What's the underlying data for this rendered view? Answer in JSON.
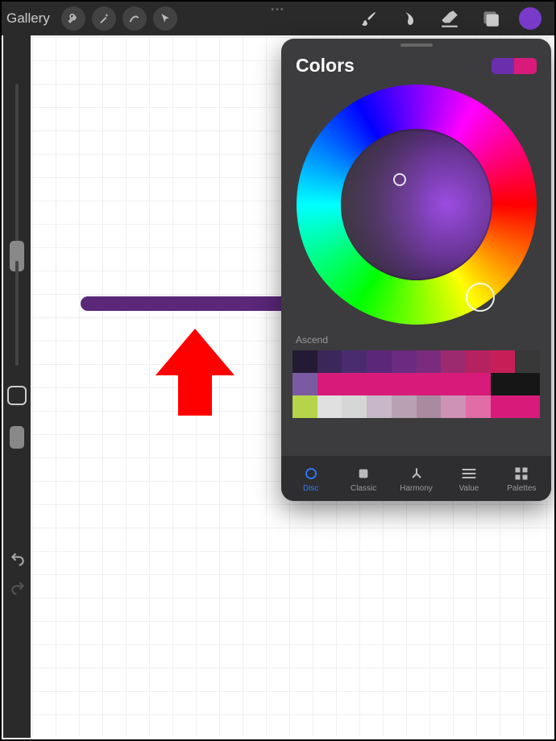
{
  "topbar": {
    "gallery_label": "Gallery"
  },
  "colors_panel": {
    "title": "Colors",
    "history_label": "Ascend",
    "current_color": "#7a3bcb",
    "secondary_color": "#d81b7a",
    "tabs": {
      "disc": "Disc",
      "classic": "Classic",
      "harmony": "Harmony",
      "value": "Value",
      "palettes": "Palettes"
    },
    "active_tab": "Disc",
    "palette_rows": [
      [
        "#231a33",
        "#3b2759",
        "#4b2b70",
        "#5a2779",
        "#6b2b80",
        "#7b2b7e",
        "#9b2b6e",
        "#b52260",
        "#c81e58",
        "#383838"
      ],
      [
        "#7a5aa0",
        "#d81b7a",
        "#d81b7a",
        "#d81b7a",
        "#d81b7a",
        "#d81b7a",
        "#d81b7a",
        "#d81b7a",
        "#161616",
        "#161616"
      ],
      [
        "#b6d44a",
        "#e0e0e0",
        "#d6d6d6",
        "#c7b7c8",
        "#b7a1b3",
        "#a88b9e",
        "#cf92b7",
        "#e06da6",
        "#d81b7a",
        "#d81b7a"
      ]
    ]
  },
  "annotation": {
    "stroke_color": "#5a2779",
    "arrow_color": "#ff0000"
  },
  "icons": {
    "wrench": "wrench-icon",
    "wand": "wand-icon",
    "selection": "selection-icon",
    "cursor": "cursor-icon",
    "brush": "brush-icon",
    "smudge": "smudge-icon",
    "eraser": "eraser-icon",
    "layers": "layers-icon"
  }
}
